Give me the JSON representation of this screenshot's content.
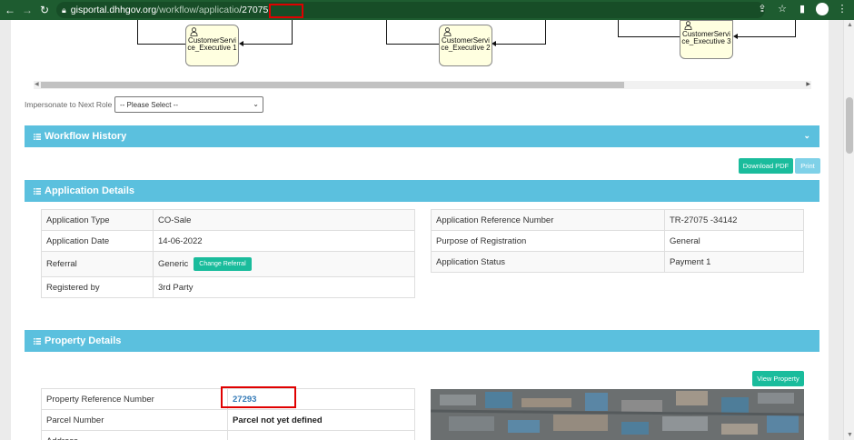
{
  "browser": {
    "url_host": "gisportal.dhhgov.org",
    "url_path": "/workflow/applicatio",
    "url_highlight": "/27075"
  },
  "workflow": {
    "nodes": [
      {
        "label": "CustomerServi ce_Executive 1"
      },
      {
        "label": "CustomerServi ce_Executive 2"
      },
      {
        "label": "CustomerServi ce_Executive 3"
      }
    ],
    "impersonate_label": "Impersonate to Next Role",
    "impersonate_value": "-- Please Select --"
  },
  "workflow_history": {
    "title": "Workflow History"
  },
  "actions": {
    "download_pdf": "Download PDF",
    "print": "Print"
  },
  "application_details": {
    "title": "Application Details",
    "left_rows": [
      {
        "label": "Application Type",
        "value": "CO-Sale"
      },
      {
        "label": "Application Date",
        "value": "14-06-2022"
      },
      {
        "label": "Referral",
        "value": "Generic"
      },
      {
        "label": "Registered by",
        "value": "3rd Party"
      }
    ],
    "change_referral": "Change Referral",
    "right_rows": [
      {
        "label": "Application Reference Number",
        "value": "TR-27075 -34142"
      },
      {
        "label": "Purpose of Registration",
        "value": "General"
      },
      {
        "label": "Application Status",
        "value": "Payment 1"
      }
    ]
  },
  "property_details": {
    "title": "Property Details",
    "view_property": "View Property",
    "rows": [
      {
        "label": "Property Reference Number",
        "value": "27293"
      },
      {
        "label": "Parcel Number",
        "value": "Parcel not yet defined"
      },
      {
        "label": "Address",
        "value": ""
      }
    ]
  },
  "colors": {
    "panel_header": "#5bc0de",
    "button_green": "#1abc9c",
    "highlight_box": "#e00000",
    "browser_bar": "#1e5c30"
  }
}
